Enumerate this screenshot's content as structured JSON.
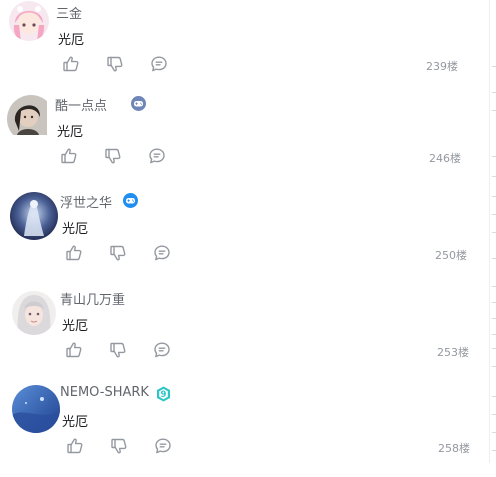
{
  "comments": [
    {
      "username": "三金",
      "text": "光厄",
      "floor": "239楼",
      "avatar_icon": "pink-hair-anime-avatar",
      "badge": null
    },
    {
      "username": "酷一点点",
      "text": "光厄",
      "floor": "246楼",
      "avatar_icon": "dark-hair-avatar",
      "badge": "gamepad-badge-icon",
      "badge_color": "#6f86b8"
    },
    {
      "username": "浮世之华",
      "text": "光厄",
      "floor": "250楼",
      "avatar_icon": "blue-fantasy-avatar",
      "badge": "gamepad-badge-icon",
      "badge_color": "#1e8ff0"
    },
    {
      "username": "青山几万重",
      "text": "光厄",
      "floor": "253楼",
      "avatar_icon": "silver-hair-avatar",
      "badge": null
    },
    {
      "username": "NEMO-SHARK",
      "text": "光厄",
      "floor": "258楼",
      "avatar_icon": "blue-sky-avatar",
      "badge": "level-9-badge-icon",
      "badge_color": "#2cc5c5",
      "badge_text": "9"
    }
  ],
  "action_icons": [
    "like-icon",
    "dislike-icon",
    "reply-icon"
  ],
  "colors": {
    "username": "#61666d",
    "text": "#18191c",
    "icon": "#9499a0",
    "floor": "#9499a0"
  }
}
